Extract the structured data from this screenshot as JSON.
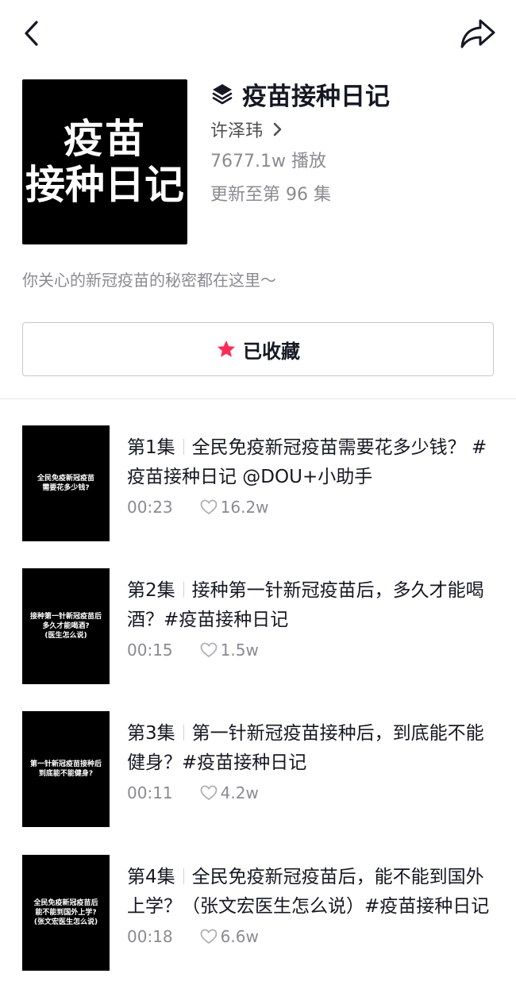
{
  "header": {
    "cover_line1": "疫苗",
    "cover_line2": "接种日记",
    "title": "疫苗接种日记",
    "author": "许泽玮",
    "plays": "7677.1w 播放",
    "updated": "更新至第 96 集"
  },
  "description": "你关心的新冠疫苗的秘密都在这里～",
  "favorite_button": {
    "label": "已收藏",
    "color": "#fe2c55"
  },
  "episodes": [
    {
      "number": "第1集",
      "title": "全民免疫新冠疫苗需要花多少钱？ #疫苗接种日记 @DOU+小助手",
      "duration": "00:23",
      "likes": "16.2w",
      "thumb_text": "全民免疫新冠疫苗\n需要花多少钱?"
    },
    {
      "number": "第2集",
      "title": "接种第一针新冠疫苗后，多久才能喝酒？#疫苗接种日记",
      "duration": "00:15",
      "likes": "1.5w",
      "thumb_text": "接种第一针新冠疫苗后\n多久才能喝酒?\n(医生怎么说)"
    },
    {
      "number": "第3集",
      "title": "第一针新冠疫苗接种后，到底能不能健身？#疫苗接种日记",
      "duration": "00:11",
      "likes": "4.2w",
      "thumb_text": "第一针新冠疫苗接种后\n到底能不能健身?"
    },
    {
      "number": "第4集",
      "title": "全民免疫新冠疫苗后，能不能到国外上学？（张文宏医生怎么说）#疫苗接种日记",
      "duration": "00:18",
      "likes": "6.6w",
      "thumb_text": "全民免疫新冠疫苗后\n能不能到国外上学?\n(张文宏医生怎么说)"
    }
  ]
}
